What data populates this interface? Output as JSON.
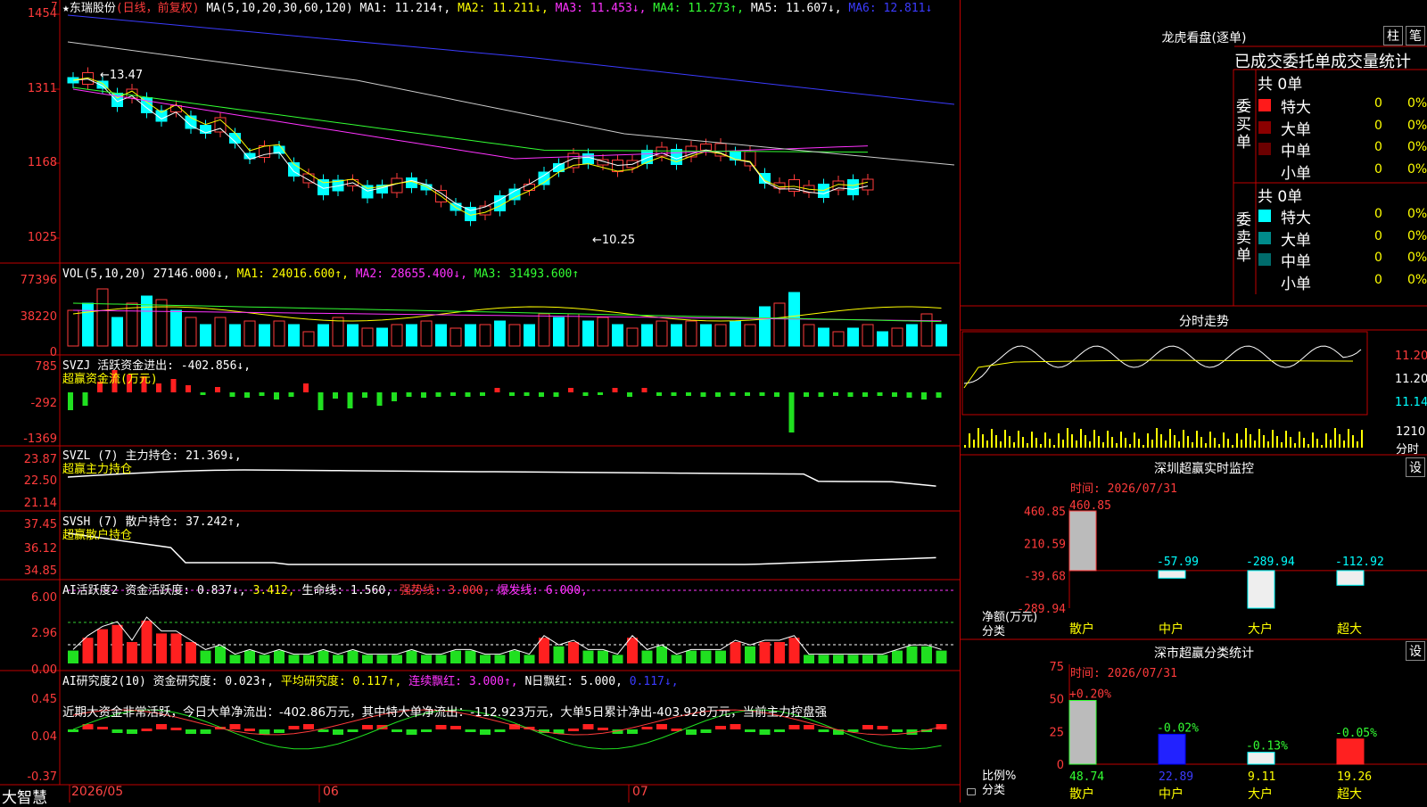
{
  "main": {
    "stock_name": "★东瑞股份",
    "period": "(日线，前复权)",
    "ma_label": "MA(5,10,20,30,60,120)",
    "ma1": "MA1: 11.214↑,",
    "ma2": "MA2: 11.211↓,",
    "ma3": "MA3: 11.453↓,",
    "ma4": "MA4: 11.273↑,",
    "ma5": "MA5: 11.607↓,",
    "ma6": "MA6: 12.811↓",
    "y_ticks": [
      "1454",
      "1311",
      "1168",
      "1025"
    ],
    "high_label": "13.47",
    "low_label": "10.25",
    "corner_mark": "7"
  },
  "volume": {
    "label": "VOL(5,10,20)",
    "val": "27146.000↓,",
    "ma1": "MA1: 24016.600↑,",
    "ma2": "MA2: 28655.400↓,",
    "ma3": "MA3: 31493.600↑",
    "y_ticks": [
      "77396",
      "38220",
      "0"
    ]
  },
  "svzj": {
    "label": "SVZJ  活跃资金进出: -402.856↓,",
    "sub": "超赢资金流(万元)",
    "y_ticks": [
      "785",
      "-292",
      "-1369"
    ]
  },
  "svzl": {
    "label": "SVZL (7) 主力持仓: 21.369↓,",
    "sub": "超赢主力持仓",
    "y_ticks": [
      "23.87",
      "22.50",
      "21.14"
    ]
  },
  "svsh": {
    "label": "SVSH (7) 散户持仓: 37.242↑,",
    "sub": "超赢散户持仓",
    "y_ticks": [
      "37.45",
      "36.12",
      "34.85"
    ]
  },
  "ai_active": {
    "label": "AI活跃度2 资金活跃度: 0.837↓,",
    "v2": "3.412,",
    "v3": "生命线: 1.560,",
    "v4": "强势线: 3.000,",
    "v5": "爆发线: 6.000,",
    "y_ticks": [
      "6.00",
      "2.96",
      "0.00"
    ]
  },
  "ai_research": {
    "label": "AI研究度2(10) 资金研究度: 0.023↑,",
    "v2": "平均研究度: 0.117↑,",
    "v3": "连续飘红: 3.000↑,",
    "v4": "N日飘红: 5.000,",
    "v5": "0.117↓,",
    "comment": "近期大资金非常活跃，今日大单净流出：-402.86万元，其中特大单净流出：-112.923万元，大单5日累计净出-403.928万元，当前主力控盘强",
    "y_ticks": [
      "0.45",
      "0.04",
      "-0.37"
    ]
  },
  "x_axis": {
    "brand": "大智慧",
    "ticks": [
      "2026/05",
      "06",
      "07"
    ]
  },
  "dragon": {
    "title": "龙虎看盘(逐单)",
    "btn1": "柱",
    "btn2": "笔",
    "subtitle": "已成交委托单成交量统计",
    "buy_total": "共 0单",
    "sell_total": "共 0单",
    "buy_label": "委买单",
    "sell_label": "委卖单",
    "rows": [
      {
        "name": "特大",
        "v": "0",
        "p": "0%"
      },
      {
        "name": "大单",
        "v": "0",
        "p": "0%"
      },
      {
        "name": "中单",
        "v": "0",
        "p": "0%"
      },
      {
        "name": "小单",
        "v": "0",
        "p": "0%"
      }
    ]
  },
  "intraday": {
    "title": "分时走势",
    "prices": [
      "11.20",
      "11.20",
      "11.14"
    ],
    "vol": "1210",
    "vol_label": "分时"
  },
  "monitor": {
    "title": "深圳超赢实时监控",
    "btn": "设",
    "time": "时间: 2026/07/31",
    "y_ticks": [
      "460.85",
      "210.59",
      "-39.68",
      "-289.94"
    ],
    "axis_label": "净额(万元)",
    "cat_label": "分类",
    "bars": [
      {
        "name": "散户",
        "value": 460.85,
        "label": "460.85"
      },
      {
        "name": "中户",
        "value": -57.99,
        "label": "-57.99"
      },
      {
        "name": "大户",
        "value": -289.94,
        "label": "-289.94"
      },
      {
        "name": "超大",
        "value": -112.92,
        "label": "-112.92"
      }
    ]
  },
  "classify": {
    "title": "深市超赢分类统计",
    "btn": "设",
    "time": "时间: 2026/07/31",
    "y_ticks": [
      "75",
      "50",
      "25",
      "0"
    ],
    "axis_label": "比例%",
    "cat_label": "分类",
    "bars": [
      {
        "name": "散户",
        "value": 48.74,
        "label": "48.74",
        "chg": "+0.20%"
      },
      {
        "name": "中户",
        "value": 22.89,
        "label": "22.89",
        "chg": "-0.02%"
      },
      {
        "name": "大户",
        "value": 9.11,
        "label": "9.11",
        "chg": "-0.13%"
      },
      {
        "name": "超大",
        "value": 19.26,
        "label": "19.26",
        "chg": "-0.05%"
      }
    ]
  },
  "chart_data": {
    "type": "bar",
    "title": "深圳超赢实时监控",
    "ylabel": "净额(万元)",
    "categories": [
      "散户",
      "中户",
      "大户",
      "超大"
    ],
    "values": [
      460.85,
      -57.99,
      -289.94,
      -112.92
    ],
    "ylim": [
      -289.94,
      460.85
    ]
  }
}
